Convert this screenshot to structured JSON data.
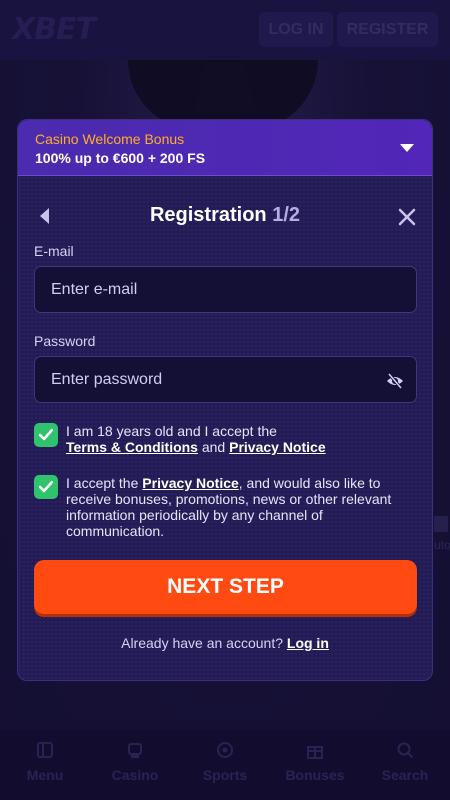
{
  "header": {
    "logo_text": "XBET",
    "login_label": "LOG IN",
    "register_label": "REGISTER"
  },
  "bonus": {
    "title": "Casino Welcome Bonus",
    "subtitle": "100% up to €600 + 200 FS"
  },
  "registration": {
    "title": "Registration",
    "step": "1/2"
  },
  "email": {
    "label": "E-mail",
    "placeholder": "Enter e-mail"
  },
  "password": {
    "label": "Password",
    "placeholder": "Enter password"
  },
  "consent_age": {
    "checked": true,
    "text_1": "I am 18 years old and I accept the",
    "terms_link": "Terms & Conditions",
    "and": "and",
    "privacy_link": "Privacy Notice"
  },
  "consent_marketing": {
    "checked": true,
    "text_1": "I accept the",
    "privacy_link": "Privacy Notice",
    "text_2": ", and would also like to receive bonuses, promotions, news or other relevant information periodically by any channel of communication."
  },
  "next_step_label": "NEXT STEP",
  "have_account": {
    "text": "Already have an account?",
    "login_link": "Log in"
  },
  "side_peek_text": "uto",
  "bottom_nav": {
    "items": [
      {
        "label": "Menu",
        "icon": "menu-icon"
      },
      {
        "label": "Casino",
        "icon": "casino-icon"
      },
      {
        "label": "Sports",
        "icon": "sports-ball-icon"
      },
      {
        "label": "Bonuses",
        "icon": "gift-icon"
      },
      {
        "label": "Search",
        "icon": "search-icon"
      }
    ]
  },
  "colors": {
    "accent": "#ff4a12",
    "check": "#2fc36d",
    "bonus_gold": "#ffb020",
    "background": "#1a1340"
  }
}
